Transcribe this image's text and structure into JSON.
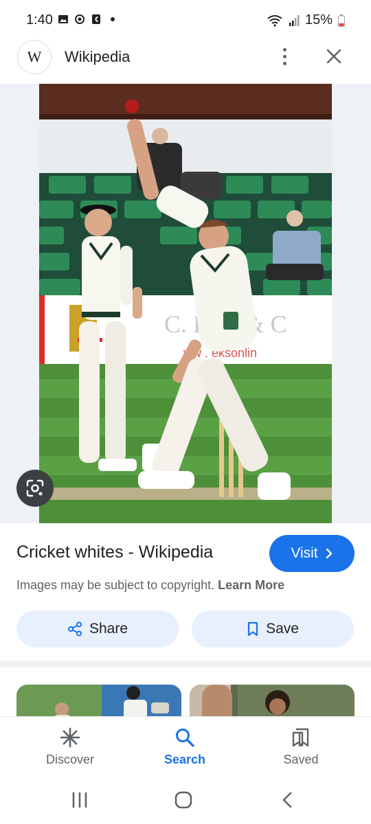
{
  "status_bar": {
    "time": "1:40",
    "battery": "15%",
    "left_icons": [
      "image-icon",
      "sync-icon",
      "c-app-icon",
      "dot-icon"
    ],
    "right_icons": [
      "wifi-icon",
      "signal-icon",
      "battery-icon"
    ]
  },
  "header": {
    "logo_letter": "W",
    "site_name": "Wikipedia"
  },
  "image": {
    "description_icon": "lens-icon"
  },
  "result": {
    "title": "Cricket whites - Wikipedia",
    "visit_label": "Visit",
    "copyright_text": "Images may be subject to copyright.",
    "learn_more": "Learn More"
  },
  "actions": {
    "share_label": "Share",
    "save_label": "Save"
  },
  "bottom_nav": {
    "items": [
      {
        "label": "Discover",
        "icon": "discover-icon",
        "active": false
      },
      {
        "label": "Search",
        "icon": "search-icon",
        "active": true
      },
      {
        "label": "Saved",
        "icon": "saved-icon",
        "active": false
      }
    ]
  },
  "colors": {
    "accent": "#1a73e8",
    "chip_bg": "#e8f0fe",
    "text_primary": "#202124",
    "text_secondary": "#5f6368"
  }
}
